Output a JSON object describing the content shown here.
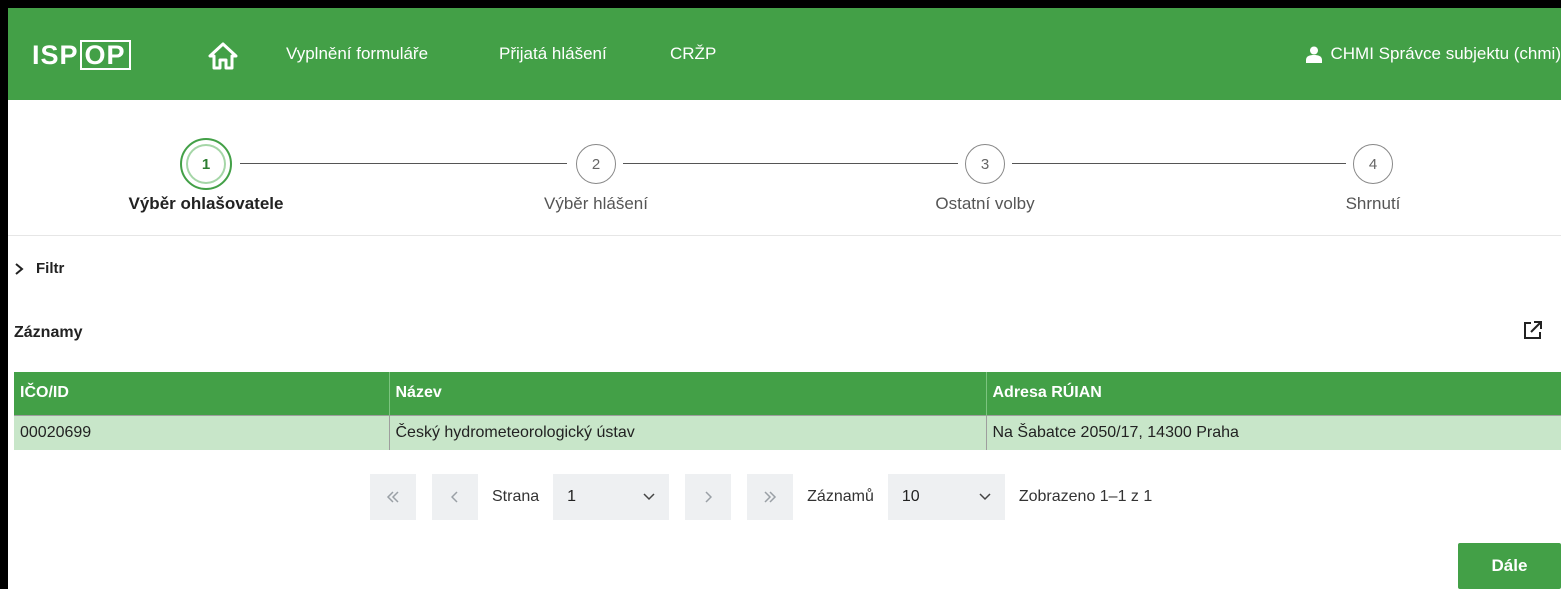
{
  "header": {
    "logo_prefix": "ISP",
    "logo_boxed": "OP",
    "nav": [
      "Vyplnění formuláře",
      "Přijatá hlášení",
      "CRŽP"
    ],
    "user": "CHMI Správce subjektu (chmi)"
  },
  "stepper": {
    "steps": [
      {
        "number": "1",
        "label": "Výběr ohlašovatele"
      },
      {
        "number": "2",
        "label": "Výběr hlášení"
      },
      {
        "number": "3",
        "label": "Ostatní volby"
      },
      {
        "number": "4",
        "label": "Shrnutí"
      }
    ]
  },
  "filter": {
    "label": "Filtr"
  },
  "records": {
    "title": "Záznamy",
    "columns": [
      "IČO/ID",
      "Název",
      "Adresa RÚIAN"
    ],
    "rows": [
      [
        "00020699",
        "Český hydrometeorologický ústav",
        "Na Šabatce 2050/17, 14300 Praha"
      ]
    ]
  },
  "pagination": {
    "page_label": "Strana",
    "page_value": "1",
    "records_label": "Záznamů",
    "records_value": "10",
    "summary": "Zobrazeno 1–1 z 1"
  },
  "actions": {
    "next_label": "Dále"
  },
  "colors": {
    "primary": "#43a047",
    "row": "#c8e6c9"
  }
}
